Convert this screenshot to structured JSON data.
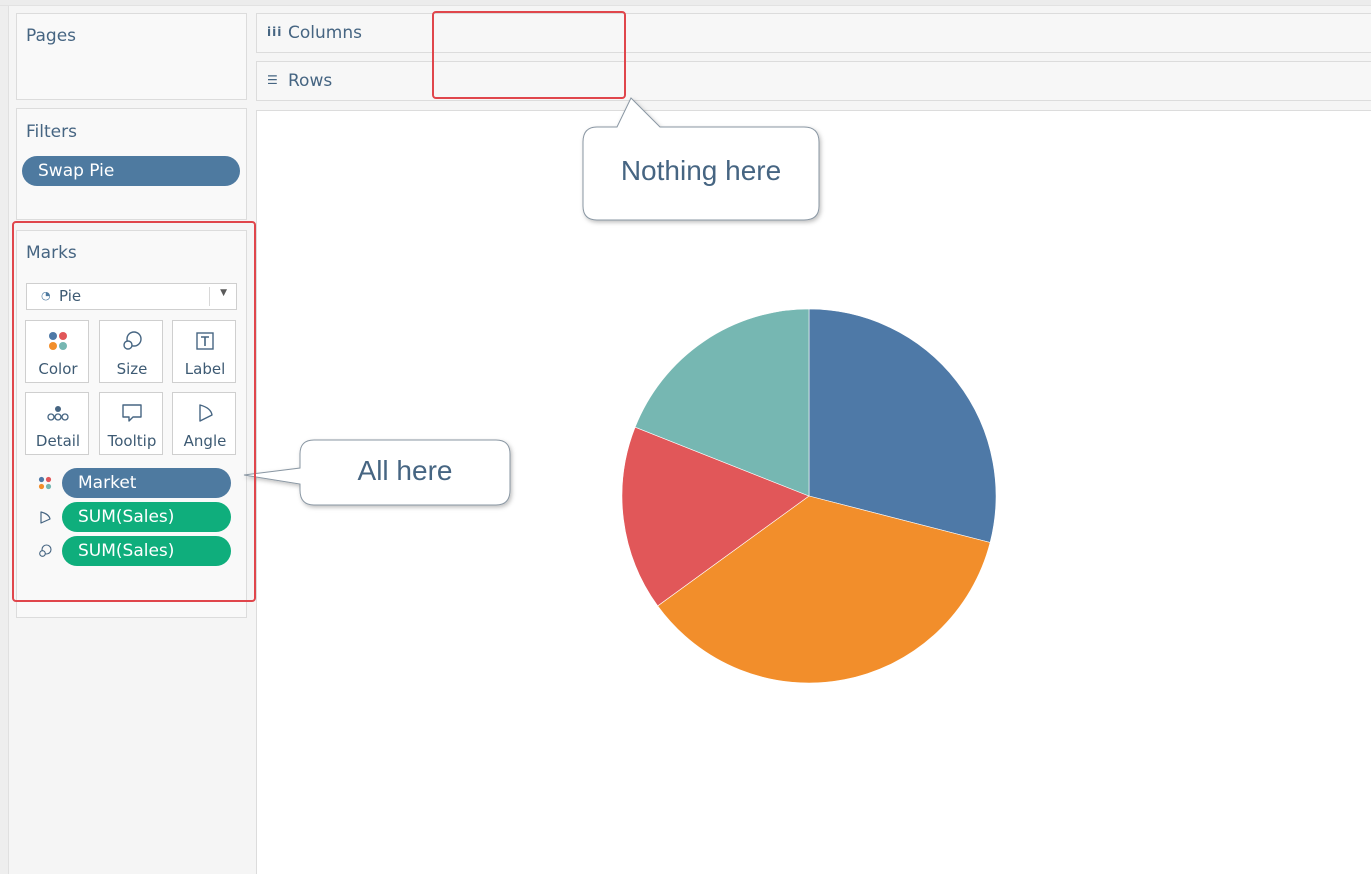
{
  "panels": {
    "pages": {
      "title": "Pages"
    },
    "filters": {
      "title": "Filters",
      "pills": [
        {
          "label": "Swap Pie"
        }
      ]
    },
    "marks": {
      "title": "Marks",
      "mark_type": {
        "icon": "pie-icon",
        "selected": "Pie"
      },
      "buttons": [
        {
          "label": "Color",
          "icon": "color-dots-icon"
        },
        {
          "label": "Size",
          "icon": "size-icon"
        },
        {
          "label": "Label",
          "icon": "label-icon"
        },
        {
          "label": "Detail",
          "icon": "detail-icon"
        },
        {
          "label": "Tooltip",
          "icon": "tooltip-icon"
        },
        {
          "label": "Angle",
          "icon": "angle-icon"
        }
      ],
      "pills": [
        {
          "label": "Market",
          "icon": "color-dots-icon",
          "color": "#4e7aa0"
        },
        {
          "label": "SUM(Sales)",
          "icon": "angle-icon",
          "color": "#0fae7c"
        },
        {
          "label": "SUM(Sales)",
          "icon": "size-icon",
          "color": "#0fae7c"
        }
      ]
    }
  },
  "shelves": {
    "columns": {
      "label": "Columns",
      "icon": "columns-icon"
    },
    "rows": {
      "label": "Rows",
      "icon": "rows-icon"
    }
  },
  "annotations": {
    "nothing_here": "Nothing here",
    "all_here": "All here",
    "highlight_color": "#e0464c"
  },
  "chart_data": {
    "type": "pie",
    "slices": [
      {
        "value": 29,
        "color": "#4e79a7"
      },
      {
        "value": 36,
        "color": "#f28e2b"
      },
      {
        "value": 16,
        "color": "#e15759"
      },
      {
        "value": 19,
        "color": "#76b7b2"
      }
    ],
    "start_angle_deg": 0,
    "direction": "clockwise"
  }
}
